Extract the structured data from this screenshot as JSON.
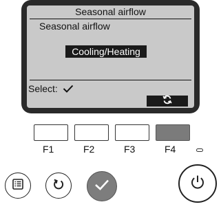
{
  "screen": {
    "title": "Seasonal airflow",
    "subtitle": "Seasonal airflow",
    "selected_value": "Cooling/Heating",
    "select_label": "Select:",
    "select_icon": "check-icon",
    "f4_icon": "cycle-icon"
  },
  "function_keys": [
    {
      "label": "F1",
      "active": false
    },
    {
      "label": "F2",
      "active": false
    },
    {
      "label": "F3",
      "active": false
    },
    {
      "label": "F4",
      "active": true
    }
  ],
  "buttons": {
    "menu_icon": "menu-icon",
    "return_icon": "return-icon",
    "select_icon": "check-icon",
    "power_icon": "power-icon"
  },
  "colors": {
    "screen_bg": "#c9c9c9",
    "bezel": "#2a2a2a",
    "active_key": "#7b7b7b",
    "select_button": "#7d7d7d"
  }
}
